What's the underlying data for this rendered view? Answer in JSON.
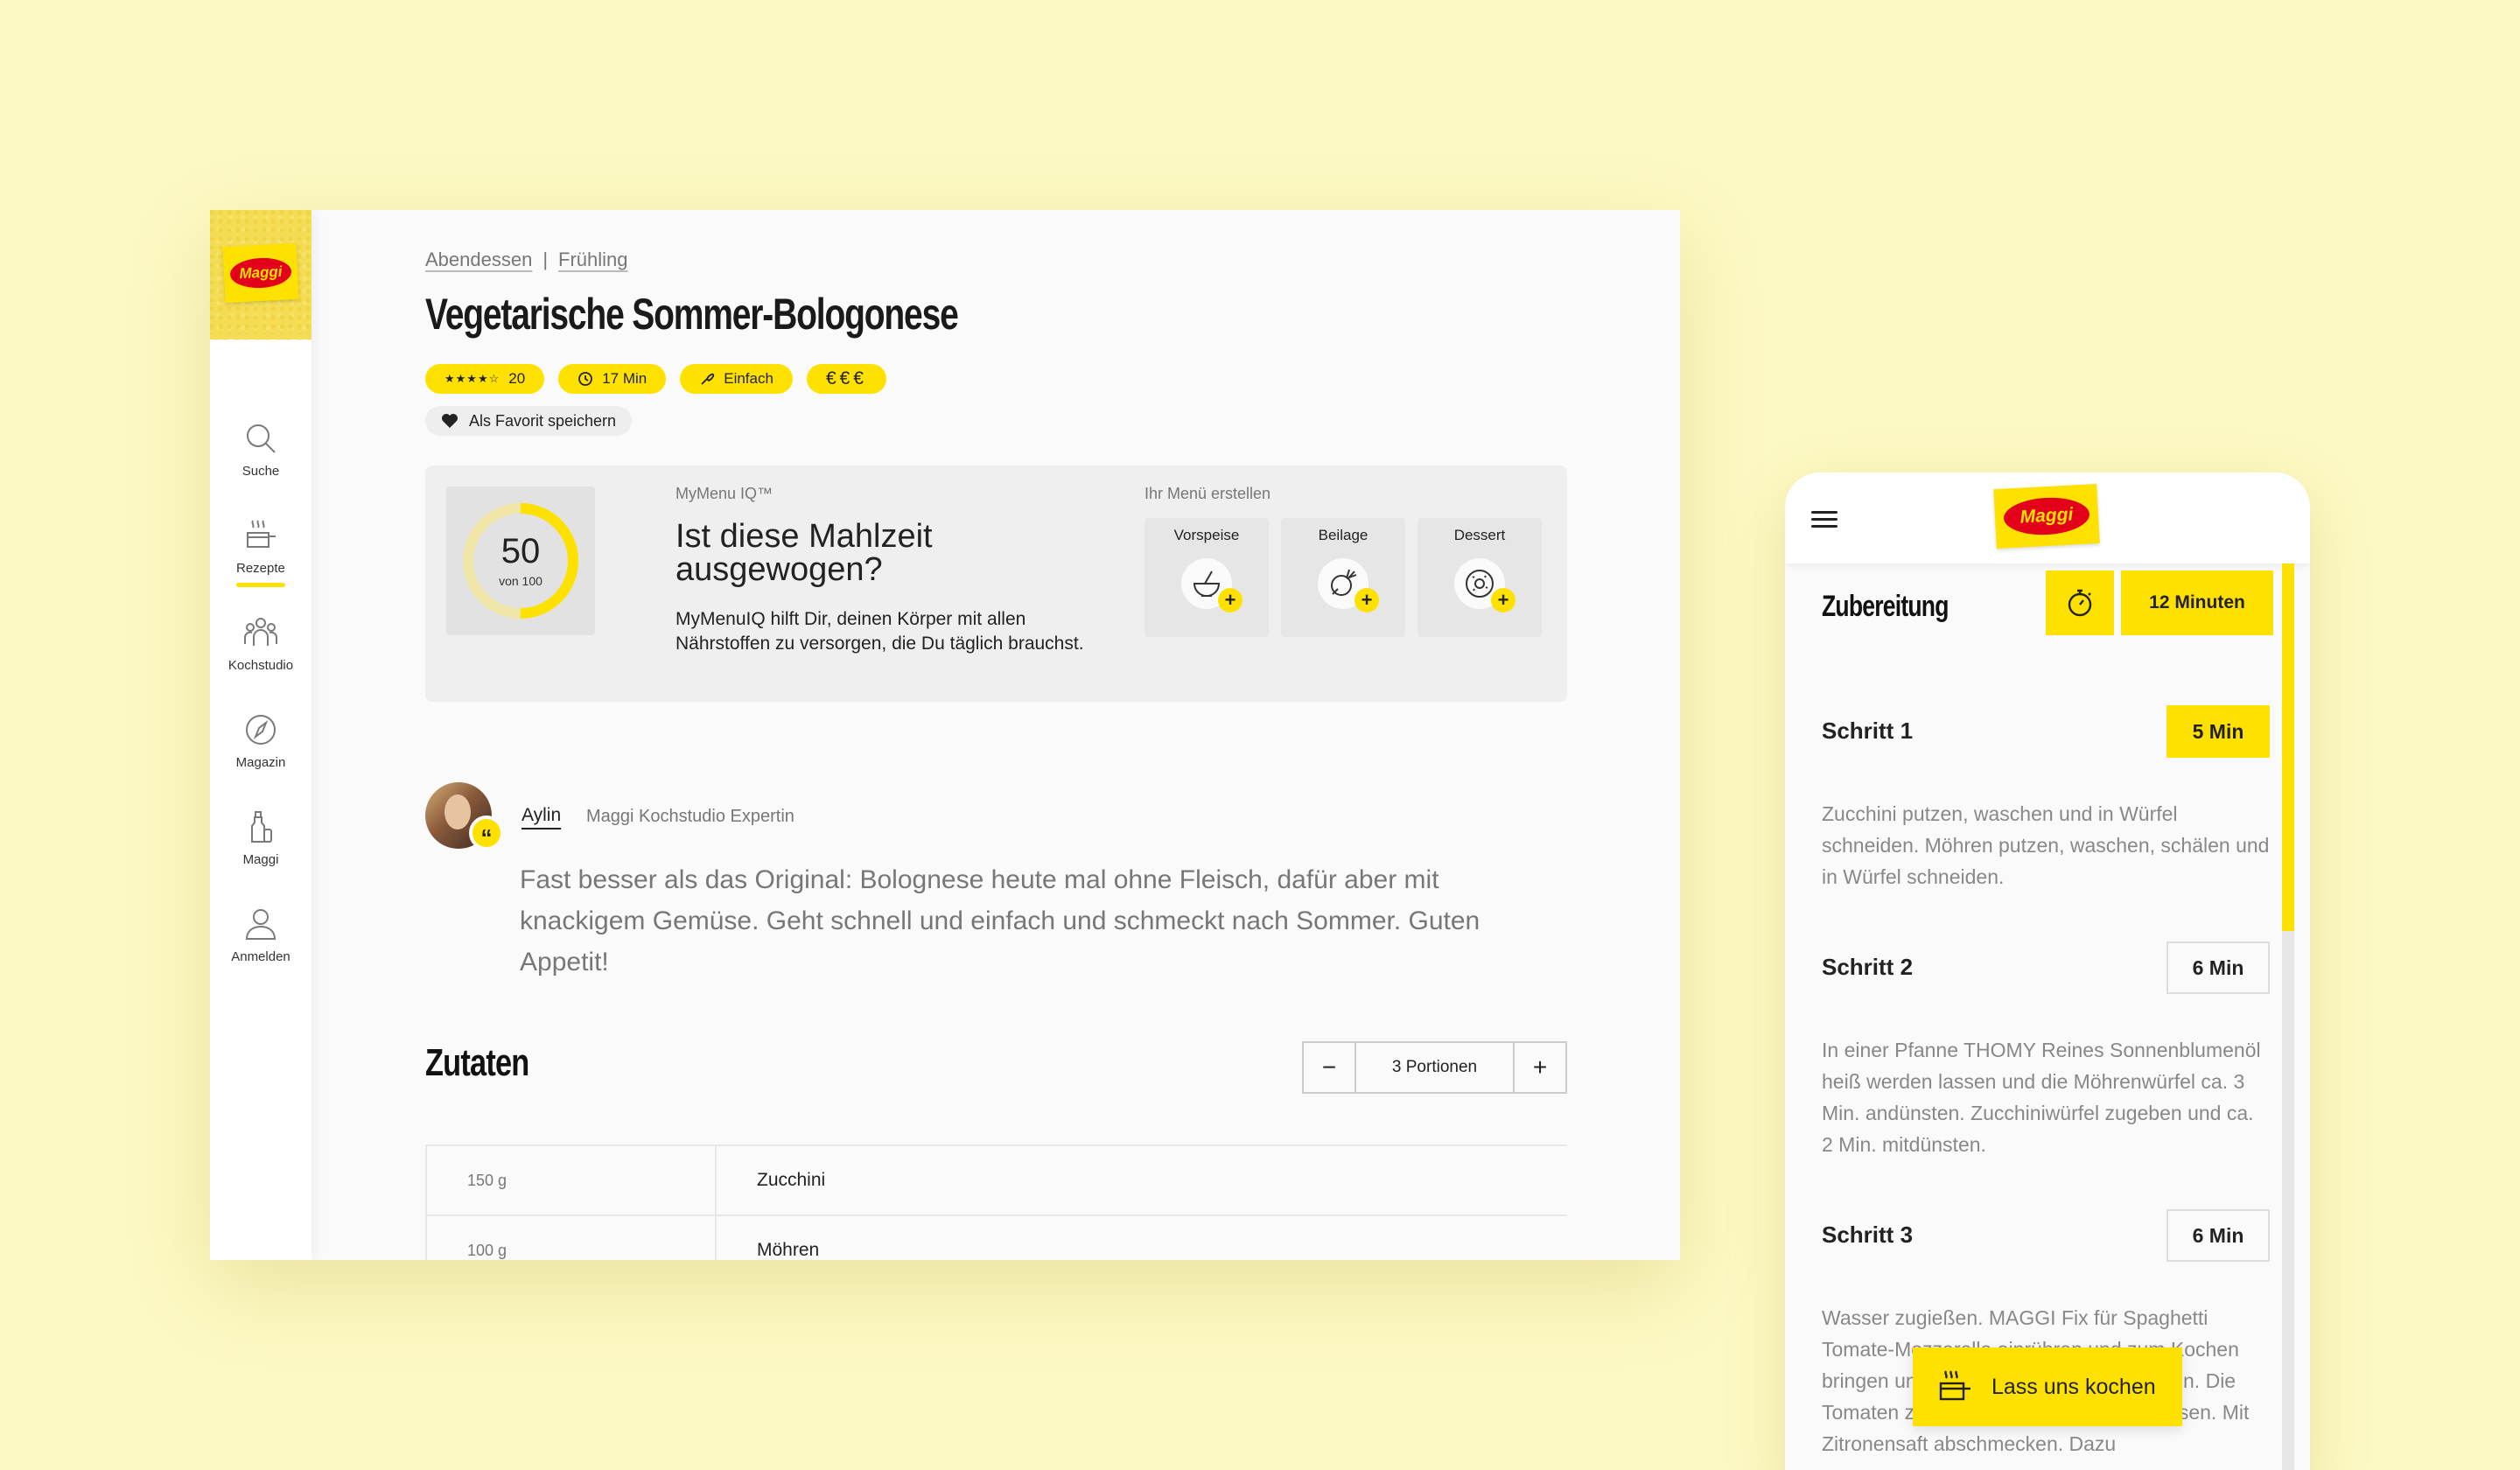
{
  "brand": {
    "logo_text": "Maggi"
  },
  "sidebar": {
    "items": [
      {
        "label": "Suche",
        "icon": "search-icon"
      },
      {
        "label": "Rezepte",
        "icon": "pot-icon",
        "active": true
      },
      {
        "label": "Kochstudio",
        "icon": "people-icon"
      },
      {
        "label": "Magazin",
        "icon": "compass-icon"
      },
      {
        "label": "Maggi",
        "icon": "bottle-icon"
      },
      {
        "label": "Anmelden",
        "icon": "user-icon"
      }
    ]
  },
  "recipe": {
    "breadcrumbs": [
      "Abendessen",
      "Frühling"
    ],
    "breadcrumb_separator": "|",
    "title": "Vegetarische Sommer-Bologonese",
    "rating_count": "20",
    "rating_stars": 4.5,
    "time": "17 Min",
    "difficulty": "Einfach",
    "price": "€€€",
    "favorite_label": "Als Favorit speichern"
  },
  "mymenu": {
    "score": "50",
    "score_sub": "von 100",
    "score_value": 50,
    "label": "MyMenu IQ™",
    "title": "Ist diese Mahlzeit ausgewogen?",
    "description": "MyMenuIQ hilft Dir, deinen Körper mit allen Nährstoffen zu versorgen, die Du täglich brauchst.",
    "menu_label": "Ihr Menü erstellen",
    "courses": [
      {
        "label": "Vorspeise",
        "icon": "bowl-icon"
      },
      {
        "label": "Beilage",
        "icon": "beet-icon"
      },
      {
        "label": "Dessert",
        "icon": "donut-icon"
      }
    ]
  },
  "author": {
    "name": "Aylin",
    "role": "Maggi Kochstudio Expertin",
    "quote": "Fast besser als das Original: Bolognese heute mal ohne Fleisch, dafür aber mit knackigem Gemüse. Geht schnell und einfach und schmeckt nach Sommer. Guten Appetit!"
  },
  "ingredients": {
    "title": "Zutaten",
    "portions": "3  Portionen",
    "minus": "−",
    "plus": "+",
    "rows": [
      {
        "amount": "150 g",
        "name": "Zucchini"
      },
      {
        "amount": "100 g",
        "name": "Möhren"
      }
    ]
  },
  "mobile": {
    "section_title": "Zubereitung",
    "total_time": "12 Minuten",
    "steps": [
      {
        "title": "Schritt 1",
        "time": "5 Min",
        "active": true,
        "text": "Zucchini putzen, waschen und in Würfel schneiden. Möhren putzen, waschen, schälen und in Würfel schneiden."
      },
      {
        "title": "Schritt 2",
        "time": "6 Min",
        "active": false,
        "text": "In einer Pfanne THOMY Reines Sonnenblumenöl heiß werden lassen und die Möhrenwürfel ca. 3 Min. andünsten. Zucchiniwürfel zugeben und ca. 2 Min. mitdünsten."
      },
      {
        "title": "Schritt 3",
        "time": "6 Min",
        "active": false,
        "text": "Wasser zugießen. MAGGI Fix für Spaghetti Tomate-Mozzarella einrühren und zum Kochen bringen und die Nudeln in dem Sud garen. Die Tomaten zugeben und warm werden lassen. Mit Zitronensaft abschmecken. Dazu"
      }
    ],
    "cook_button": "Lass uns kochen"
  },
  "colors": {
    "accent": "#ffe100",
    "brand_red": "#e3001b",
    "background": "#fdf9c3"
  }
}
